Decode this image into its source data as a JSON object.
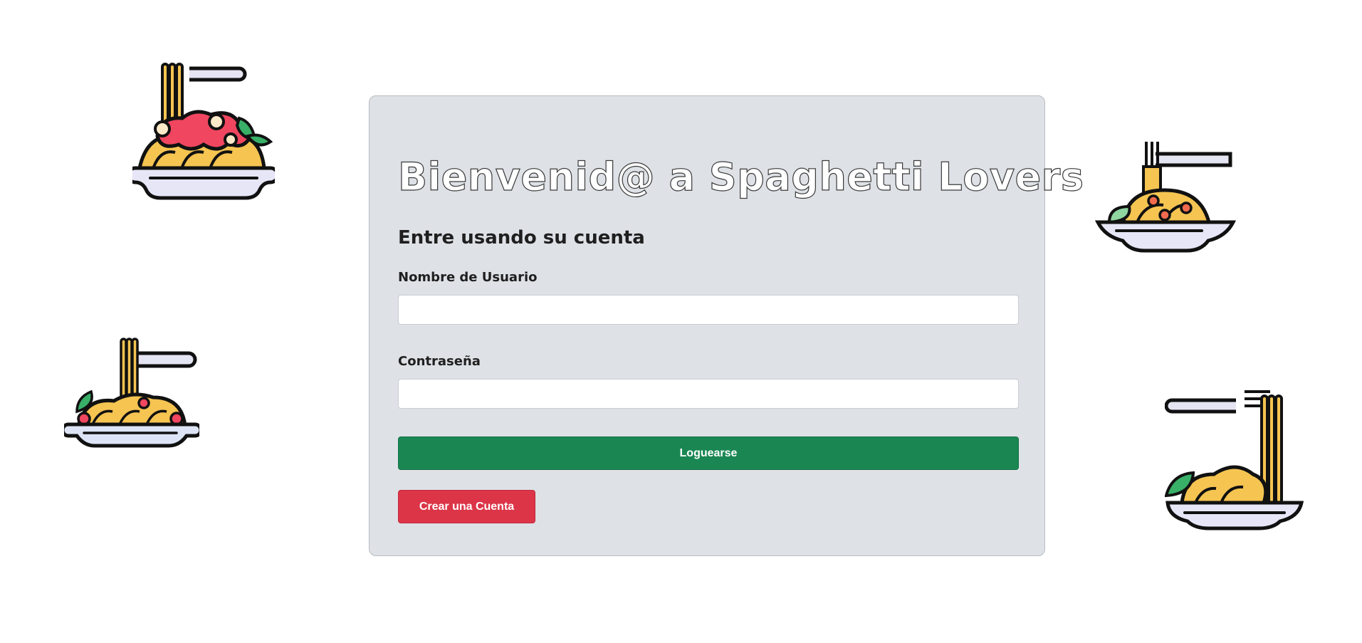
{
  "title": "Bienvenid@ a Spaghetti Lovers",
  "subtitle": "Entre usando su cuenta",
  "form": {
    "username_label": "Nombre de Usuario",
    "username_value": "",
    "password_label": "Contraseña",
    "password_value": "",
    "login_button": "Loguearse",
    "create_button": "Crear una Cuenta"
  },
  "decorations": [
    "spaghetti-bowl-with-sauce-icon",
    "spaghetti-plate-fork-icon",
    "spaghetti-plate-small-icon",
    "spaghetti-plate-fork-side-icon"
  ],
  "colors": {
    "card_bg": "#dee1e6",
    "login_button": "#1a8753",
    "create_button": "#dc3548"
  }
}
